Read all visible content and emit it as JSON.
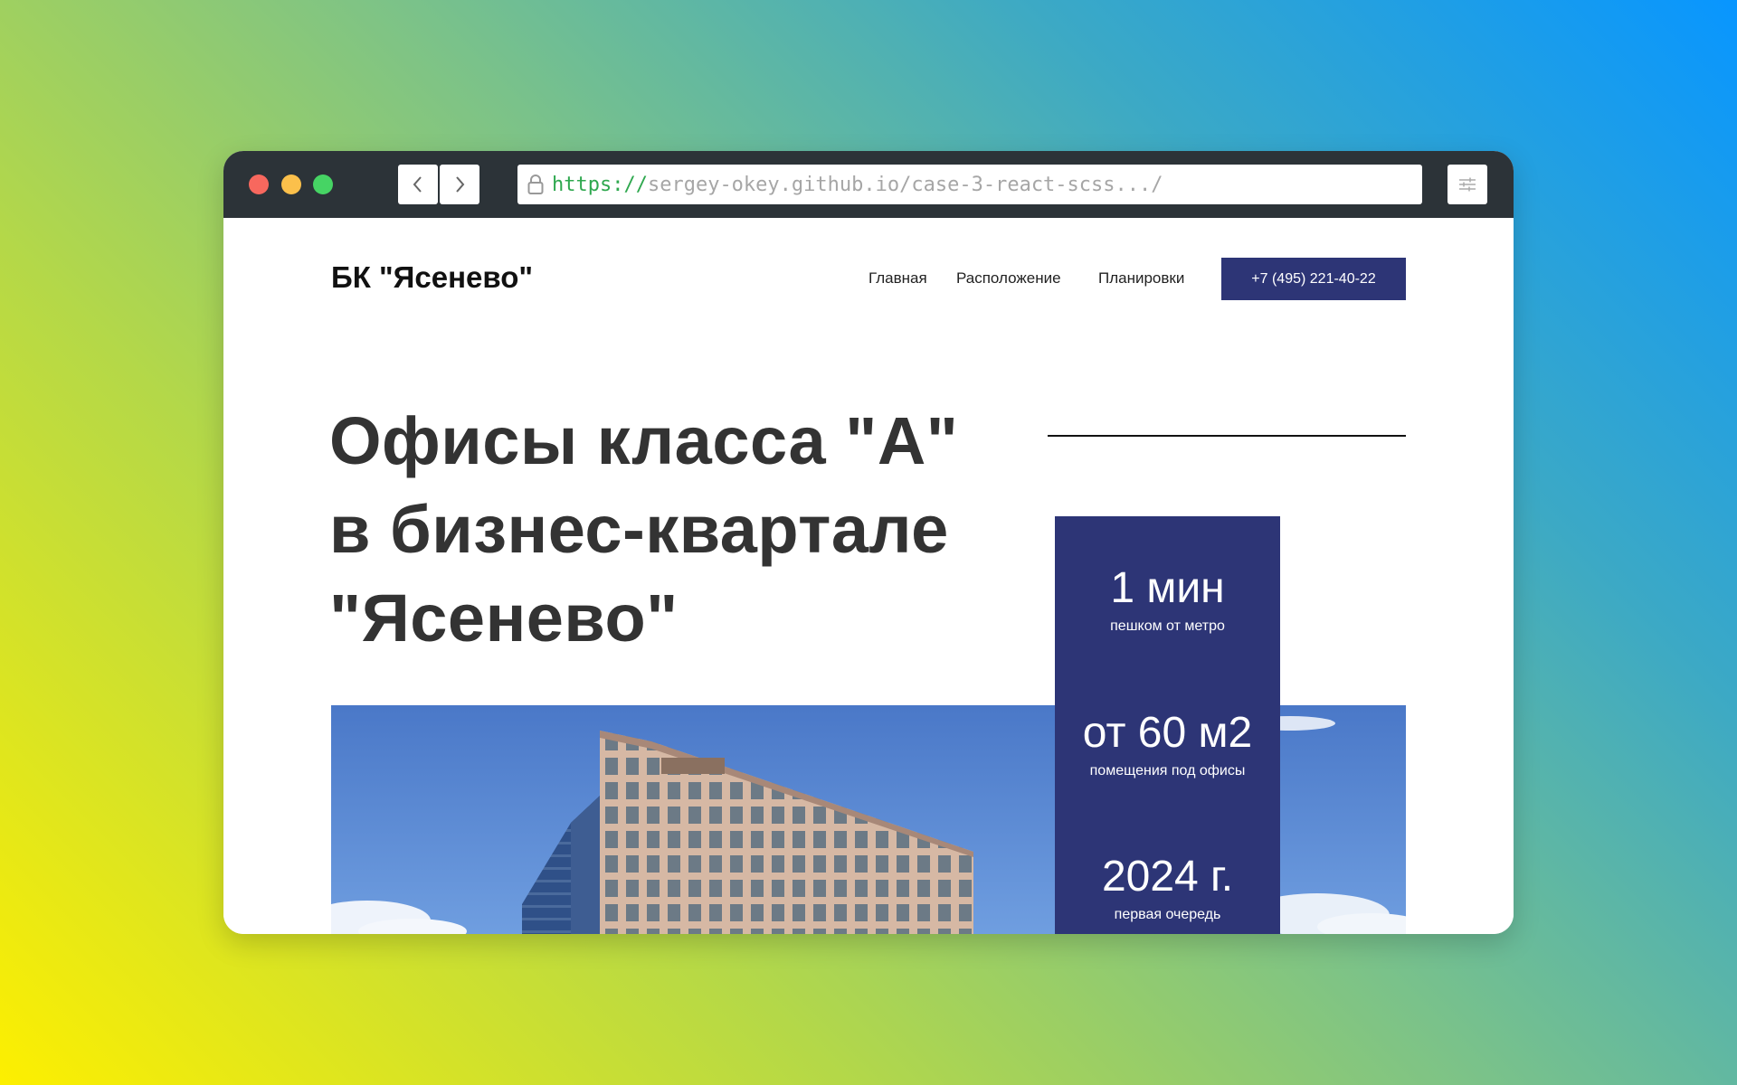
{
  "browser": {
    "url_scheme": "https://",
    "url_rest": "sergey-okey.github.io/case-3-react-scss.../"
  },
  "site": {
    "logo": "БК \"Ясенево\"",
    "nav": [
      "Главная",
      "Расположение",
      "Планировки"
    ],
    "phone": "+7 (495) 221-40-22"
  },
  "hero": {
    "title_lines": [
      "Офисы класса \"А\"",
      "в бизнес-квартале",
      "\"Ясенево\""
    ]
  },
  "stats": [
    {
      "value": "1 мин",
      "caption": "пешком от метро"
    },
    {
      "value": "от 60 м2",
      "caption": "помещения под офисы"
    },
    {
      "value": "2024 г.",
      "caption": "первая очередь"
    }
  ],
  "colors": {
    "accent": "#2d3576",
    "titlebar": "#2c3338"
  },
  "icons": [
    "chevron-left-icon",
    "chevron-right-icon",
    "lock-icon",
    "sliders-icon"
  ]
}
